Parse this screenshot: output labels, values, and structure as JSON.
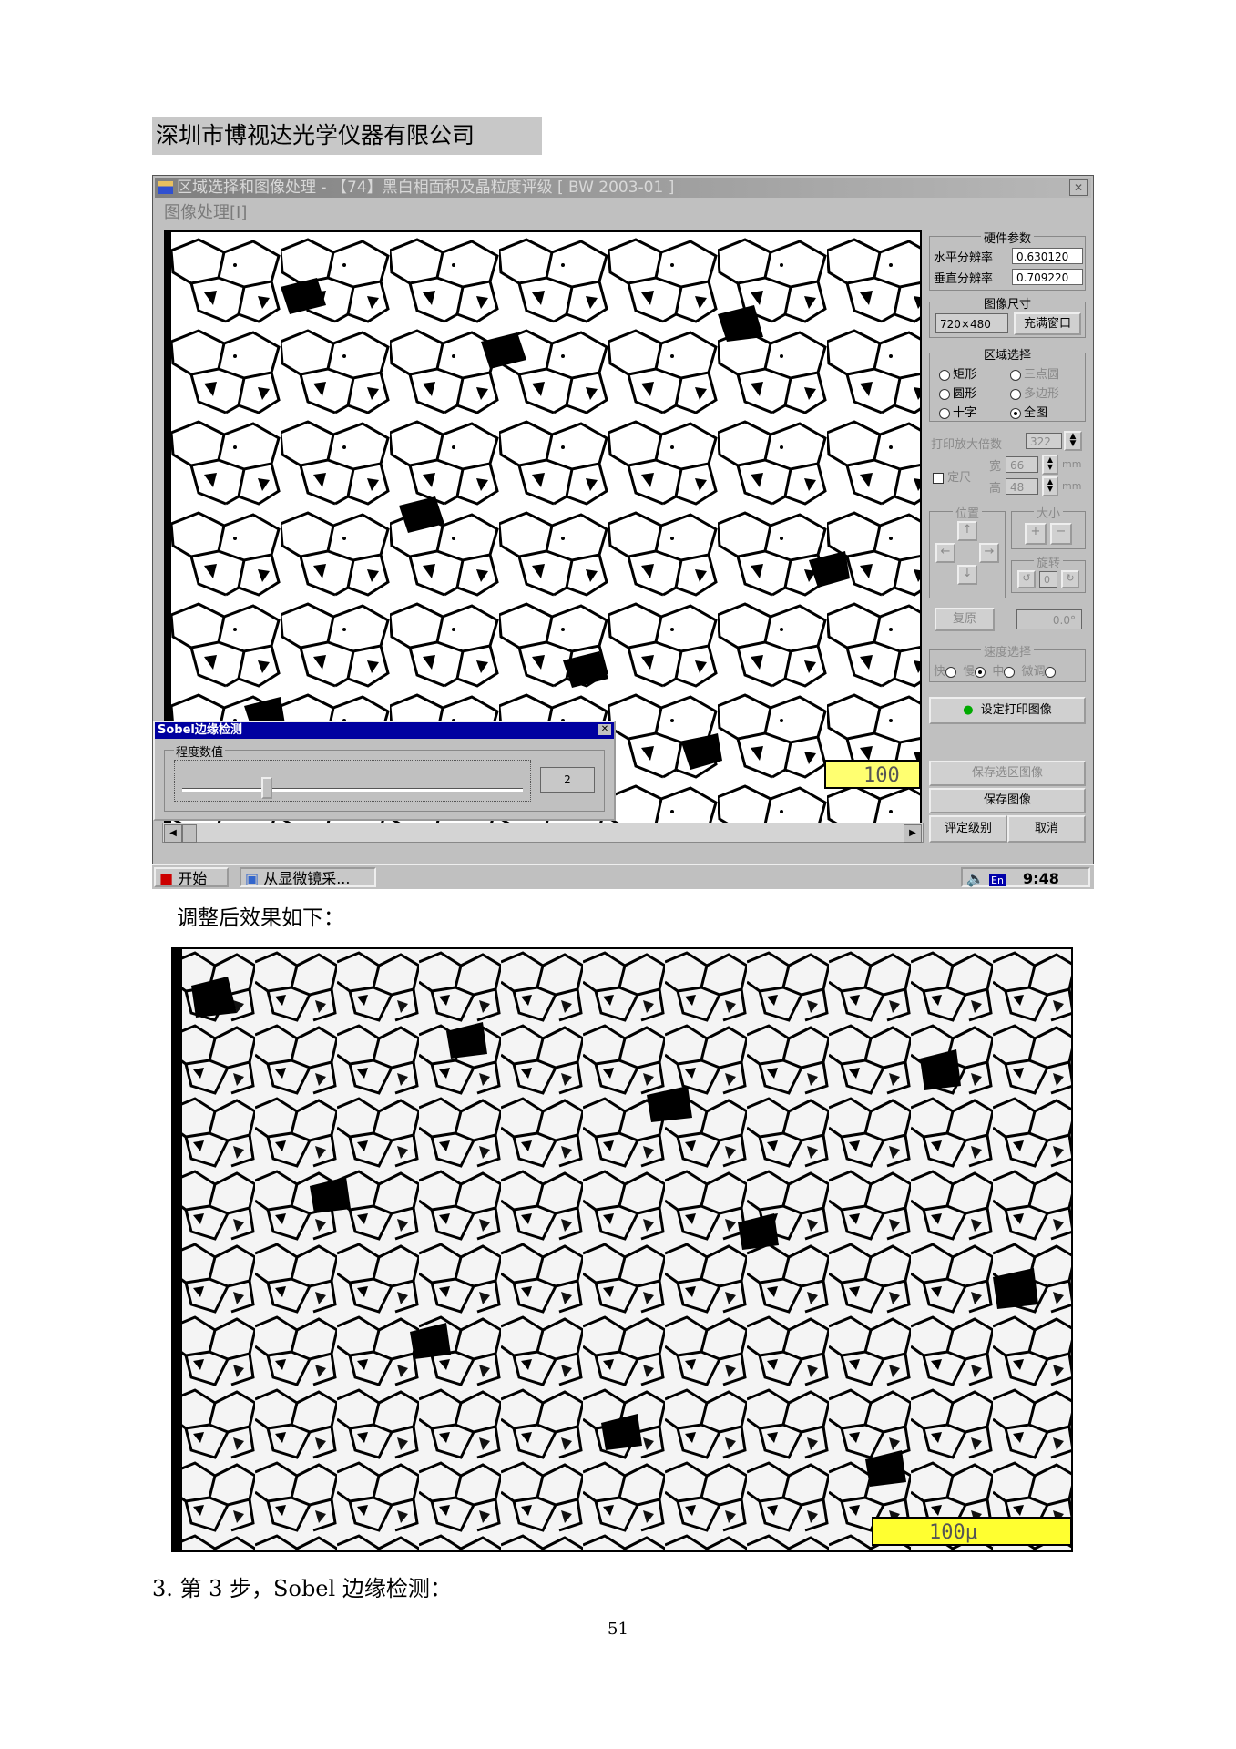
{
  "company": "深圳市博视达光学仪器有限公司",
  "window": {
    "title": "区域选择和图像处理 - 【74】黑白相面积及晶粒度评级 [ BW 2003-01 ]",
    "menu": "图像处理[I]",
    "scale_label": "100",
    "hardware": {
      "title": "硬件参数",
      "h_res_label": "水平分辨率",
      "h_res_value": "0.630120",
      "v_res_label": "垂直分辨率",
      "v_res_value": "0.709220"
    },
    "image_size": {
      "title": "图像尺寸",
      "value": "720×480",
      "fill_button": "充满窗口"
    },
    "region": {
      "title": "区域选择",
      "options": [
        "矩形",
        "三点圆",
        "圆形",
        "多边形",
        "十字",
        "全图"
      ],
      "selected": "全图"
    },
    "print": {
      "magnification_label": "打印放大倍数",
      "magnification_value": "322",
      "fixed_size_label": "定尺",
      "width_label": "宽",
      "width_value": "66",
      "height_label": "高",
      "height_value": "48",
      "unit": "mm"
    },
    "position_title": "位置",
    "size_title": "大小",
    "rotate_title": "旋转",
    "rotate_step": "0",
    "rotate_value": "0.0°",
    "reset_button": "复原",
    "speed": {
      "title": "速度选择",
      "options": [
        "快",
        "慢",
        "中",
        "微调"
      ]
    },
    "set_print_button": "设定打印图像",
    "save_region_button": "保存选区图像",
    "save_image_button": "保存图像",
    "grade_button": "评定级别",
    "cancel_button": "取消"
  },
  "sobel_dialog": {
    "title": "Sobel边缘检测",
    "group_label": "程度数值",
    "value": "2",
    "slider_fraction": 0.25
  },
  "taskbar": {
    "start": "开始",
    "task": "从显微镜采...",
    "lang": "En",
    "time": "9:48"
  },
  "caption_after": "调整后效果如下：",
  "photo_scale_label": "100μ",
  "step_text": "3. 第 3 步，Sobel 边缘检测：",
  "page_number": "51"
}
